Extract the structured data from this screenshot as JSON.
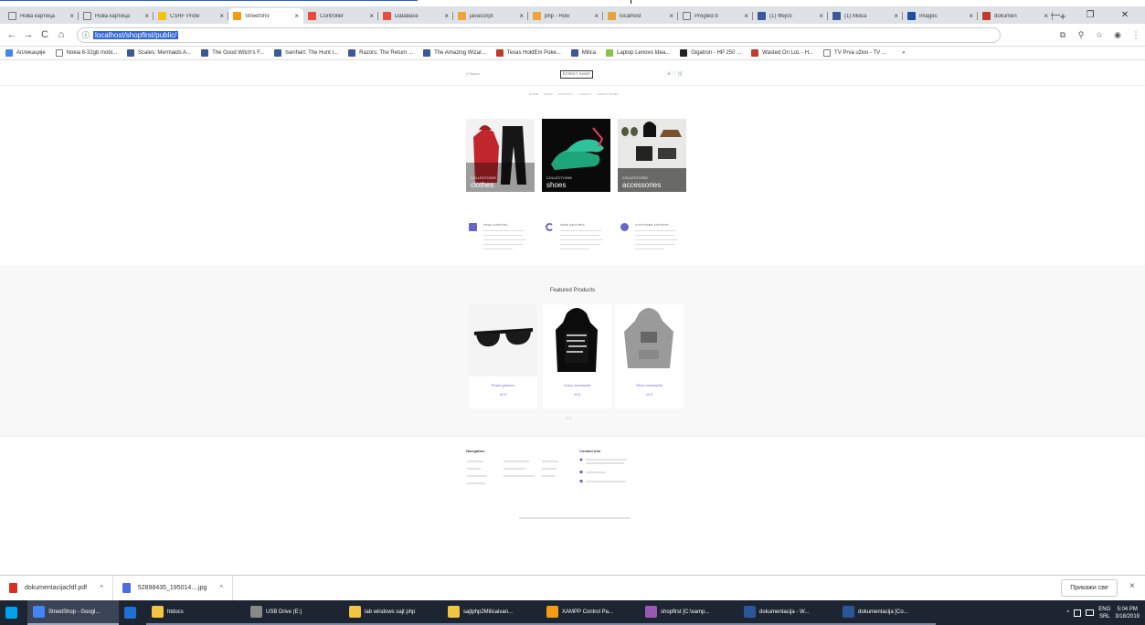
{
  "browser": {
    "tabs": [
      {
        "label": "Нова картица",
        "color": "",
        "active": false
      },
      {
        "label": "Нова картица",
        "color": "",
        "active": false
      },
      {
        "label": "CSRF Prote",
        "color": "#f1c40f",
        "active": false
      },
      {
        "label": "StreetSho",
        "color": "#f39c12",
        "active": true
      },
      {
        "label": "Controller",
        "color": "#e74c3c",
        "active": false
      },
      {
        "label": "Database",
        "color": "#e74c3c",
        "active": false
      },
      {
        "label": "javascript",
        "color": "#f1a33b",
        "active": false
      },
      {
        "label": "php - How",
        "color": "#f1a33b",
        "active": false
      },
      {
        "label": "localhost",
        "color": "#e9a23b",
        "active": false
      },
      {
        "label": "Pregled b",
        "color": "",
        "active": false
      },
      {
        "label": "(1) Фејсб",
        "color": "#3b5998",
        "active": false
      },
      {
        "label": "(1) Milica",
        "color": "#3b5998",
        "active": false
      },
      {
        "label": "Images",
        "color": "#1d4fa2",
        "active": false
      },
      {
        "label": "dokumen",
        "color": "#c0392b",
        "active": false
      }
    ],
    "new_tab": "+",
    "tab_close": "×",
    "window_controls": {
      "minimize": "—",
      "maximize": "❐",
      "close": "✕"
    },
    "nav": {
      "back": "←",
      "forward": "→",
      "reload": "C",
      "home": "⌂"
    },
    "address": {
      "info_icon": "ⓘ",
      "url": "localhost/shopfirst/public/"
    },
    "toolbar_icons": {
      "translate": "⧉",
      "zoom": "⚲",
      "star": "☆",
      "profile": "◉",
      "menu": "⋮"
    },
    "bookmarks": [
      {
        "label": "Апликације",
        "color": "#4285f4"
      },
      {
        "label": "Nokia 6-32gb mobi...",
        "color": ""
      },
      {
        "label": "Scales: Mermaids A...",
        "color": "#3b5998"
      },
      {
        "label": "The Good Witch's F...",
        "color": "#3b5998"
      },
      {
        "label": "Isenhart: The Hunt I...",
        "color": "#3b5998"
      },
      {
        "label": "Razors: The Return ...",
        "color": "#3b5998"
      },
      {
        "label": "The Amazing Wizar...",
        "color": "#3b5998"
      },
      {
        "label": "Texas HoldEm Poke...",
        "color": "#c0392b"
      },
      {
        "label": "Milica",
        "color": "#3b5998"
      },
      {
        "label": "Laptop Lenovo Idea...",
        "color": "#8bc34a"
      },
      {
        "label": "Gigatron - HP 250 ...",
        "color": "#222"
      },
      {
        "label": "Wasted On LoL - H...",
        "color": "#c0392b"
      },
      {
        "label": "TV Prva uživo - TV ...",
        "color": ""
      }
    ],
    "bookmarks_more": "»"
  },
  "shop": {
    "search": "Q  Search",
    "logo": "STREET SHOP",
    "header_icons": "♙ ♡ 🛒",
    "menu": [
      "HOME",
      "SHOP",
      "CONTACT",
      "LOGOUT",
      "ADMIN PANEL"
    ],
    "categories": [
      {
        "small": "COLLECTIONS",
        "big": "clothes"
      },
      {
        "small": "COLLECTIONS",
        "big": "shoes"
      },
      {
        "small": "COLLECTIONS",
        "big": "accessories"
      }
    ],
    "features": [
      {
        "title": "FREE SHIPPING"
      },
      {
        "title": "FREE RETURNS"
      },
      {
        "title": "CUSTOMER SUPPORT"
      }
    ],
    "featured_title": "Featured Products",
    "products": [
      {
        "name": "Prada glasses",
        "price": "60 $"
      },
      {
        "name": "Crazy sweatshirt",
        "price": "40 $"
      },
      {
        "name": "Silver sweatshirt",
        "price": "40 $"
      }
    ],
    "carousel_arrows": "‹  ›",
    "footer": {
      "nav_heading": "Navigation",
      "contact_heading": "Contact Info"
    }
  },
  "downloads": {
    "items": [
      {
        "name": "dokumentacijacfdf.pdf",
        "color": "#d93025"
      },
      {
        "name": "52898435_195014....jpg",
        "color": "#4a6ee0"
      }
    ],
    "chevron": "^",
    "show_all": "Прикажи све",
    "close": "×"
  },
  "taskbar": {
    "items": [
      {
        "label": "",
        "color": "#00a2ed"
      },
      {
        "label": "StreetShop - Googl...",
        "color": "#4285f4"
      },
      {
        "label": "",
        "color": "#1e6fd6"
      },
      {
        "label": "htdocs",
        "color": "#f4c542"
      },
      {
        "label": "USB Drive (E:)",
        "color": "#888"
      },
      {
        "label": "lab windows sajt php",
        "color": "#f4c542"
      },
      {
        "label": "sajtphp2Milicaivan...",
        "color": "#f4c542"
      },
      {
        "label": "XAMPP Control Pa...",
        "color": "#f39c12"
      },
      {
        "label": "shopfirst [C:\\xamp...",
        "color": "#9b59b6"
      },
      {
        "label": "dokumentacija - W...",
        "color": "#2b579a"
      },
      {
        "label": "dokumentacija [Co...",
        "color": "#2b579a"
      }
    ],
    "tray": {
      "chevron": "^",
      "lang_top": "ENG",
      "lang_bottom": "SRL",
      "time": "5:04 PM",
      "date": "3/18/2019"
    }
  }
}
